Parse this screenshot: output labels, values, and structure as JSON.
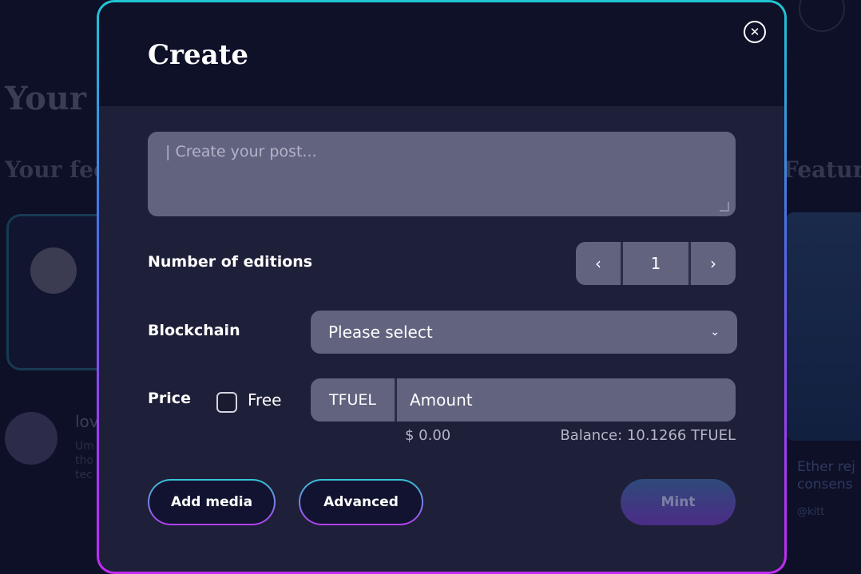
{
  "background": {
    "page_title": "Your c",
    "feed_heading": "Your fee",
    "featured_heading": "Feature",
    "feed_user": "lov",
    "feed_snippet": "Um tho tec",
    "featured_caption_1": "Ether rej",
    "featured_caption_2": "consens",
    "featured_user": "@kitt"
  },
  "modal": {
    "title": "Create",
    "close_icon": "close-icon",
    "post_placeholder": "| Create your post...",
    "editions": {
      "label": "Number of editions",
      "value": "1",
      "decrement": "‹",
      "increment": "›"
    },
    "blockchain": {
      "label": "Blockchain",
      "selected": "Please select",
      "chevron": "⌄"
    },
    "price": {
      "label": "Price",
      "free_label": "Free",
      "free_checked": false,
      "currency": "TFUEL",
      "amount_placeholder": "Amount",
      "usd_value": "$ 0.00",
      "balance": "Balance: 10.1266 TFUEL"
    },
    "buttons": {
      "add_media": "Add media",
      "advanced": "Advanced",
      "mint": "Mint"
    }
  },
  "colors": {
    "modal_bg": "#1e1f38",
    "header_bg": "#0f1129",
    "field_bg": "#62637f",
    "frame_gradient_top": "#1fc6d2",
    "frame_gradient_bottom": "#c12cf2"
  }
}
